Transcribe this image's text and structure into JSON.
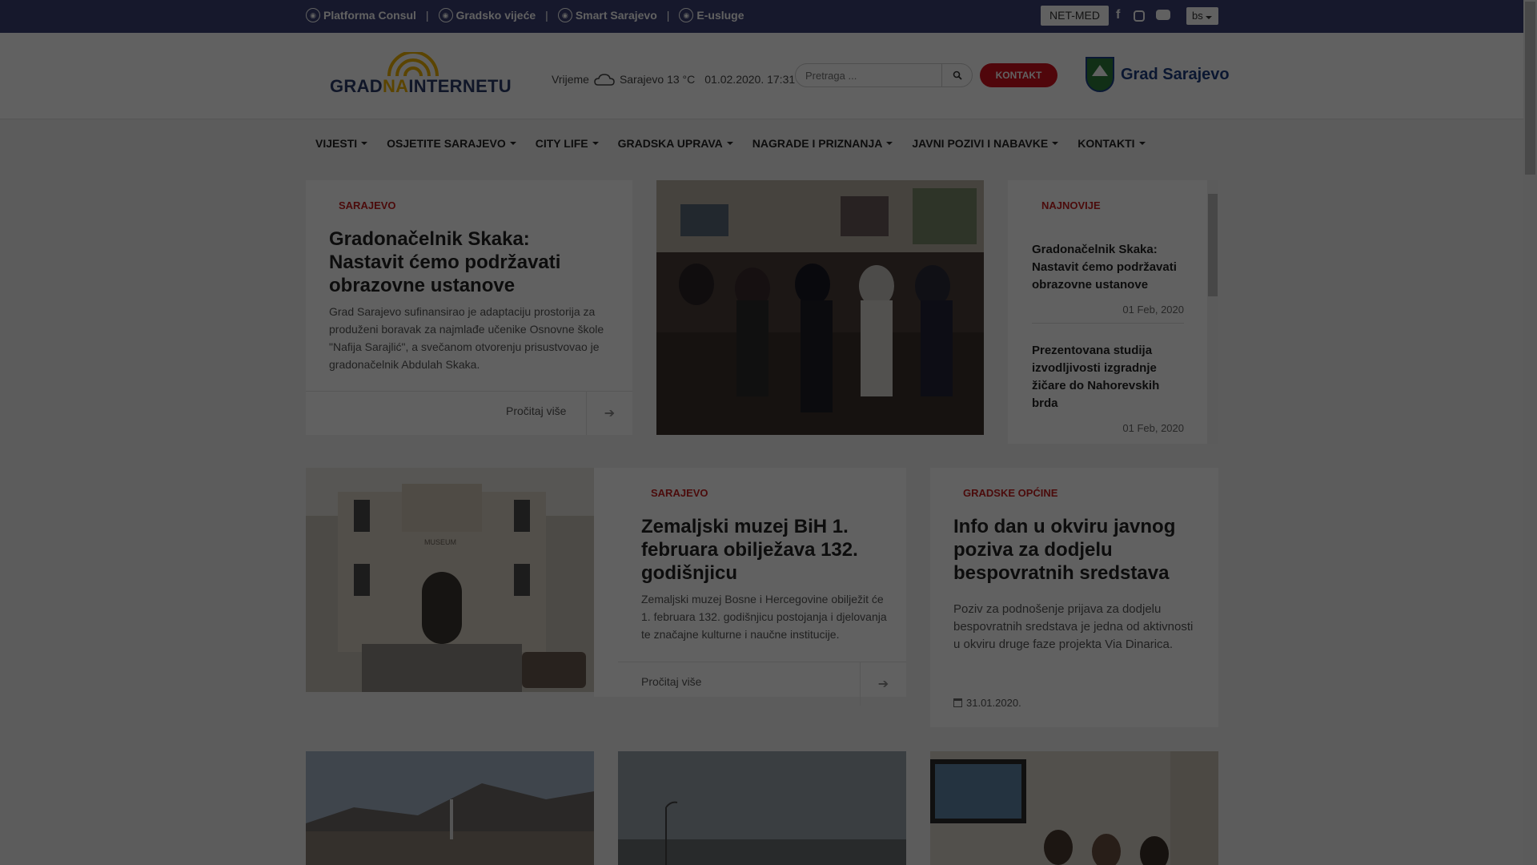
{
  "topbar": {
    "links": [
      {
        "label": "Platforma Consul",
        "icon": "consul-icon"
      },
      {
        "label": "Gradsko vijeće",
        "icon": "council-icon"
      },
      {
        "label": "Smart Sarajevo",
        "icon": "smart-icon"
      },
      {
        "label": "E-usluge",
        "icon": "eservices-icon"
      }
    ],
    "netmed": "NET-MED",
    "social": [
      "facebook-icon",
      "instagram-icon",
      "youtube-icon"
    ],
    "lang": "bs"
  },
  "header": {
    "logo_part1": "GRAD",
    "logo_part2": "NA",
    "logo_part3": "INTERNETU",
    "weather_label": "Vrijeme",
    "weather_city": "Sarajevo 13 °C",
    "datetime": "01.02.2020. 17:31",
    "search_placeholder": "Pretraga ...",
    "kontakt": "KONTAKT",
    "city_name": "Grad Sarajevo"
  },
  "nav": [
    "VIJESTI",
    "OSJETITE SARAJEVO",
    "CITY LIFE",
    "GRADSKA UPRAVA",
    "NAGRADE I PRIZNANJA",
    "JAVNI POZIVI I NABAVKE",
    "KONTAKTI"
  ],
  "featured": {
    "tag": "SARAJEVO",
    "title": "Gradonačelnik Skaka: Nastavit ćemo podržavati obrazovne ustanove",
    "excerpt": "Grad Sarajevo sufinansirao je adaptaciju prostorija za produženi boravak za najmlađe učenike Osnovne škole \"Nafija Sarajlić\", a svečanom otvorenju prisustvovao je gradonačelnik Abdulah Skaka.",
    "read_more": "Pročitaj više"
  },
  "sidebar": {
    "tag": "NAJNOVIJE",
    "items": [
      {
        "title": "Gradonačelnik Skaka: Nastavit ćemo podržavati obrazovne ustanove",
        "date": "01 Feb, 2020"
      },
      {
        "title": "Prezentovana studija izvodljivosti izgradnje žičare do Nahorevskih brda",
        "date": "01 Feb, 2020"
      }
    ]
  },
  "museum": {
    "tag": "SARAJEVO",
    "title": "Zemaljski muzej BiH 1. februara obilježava 132. godišnjicu",
    "excerpt": "Zemaljski muzej Bosne i Hercegovine obilježit će 1. februara 132. godišnjicu postojanja i djelovanja te značajne kulturne i naučne institucije.",
    "read_more": "Pročitaj više",
    "sign": "MUSEUM"
  },
  "info": {
    "tag": "GRADSKE OPĆINE",
    "title": "Info dan u okviru javnog poziva za dodjelu bespovratnih sredstava",
    "excerpt": "Poziv za podnošenje prijava za dodjelu bespovratnih sredstava je jedna od aktivnosti u okviru druge faze projekta Via Dinarica.",
    "date": "31.01.2020."
  }
}
